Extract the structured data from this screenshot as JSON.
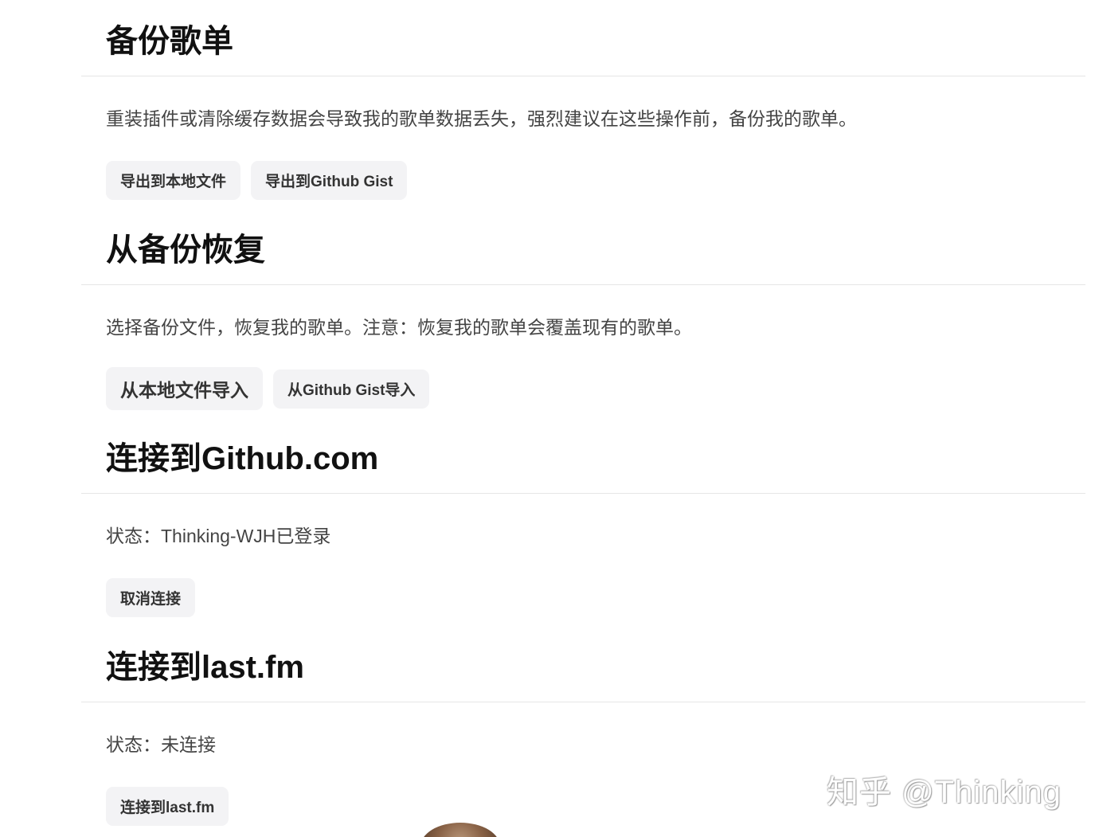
{
  "sections": {
    "backup": {
      "title": "备份歌单",
      "description": "重装插件或清除缓存数据会导致我的歌单数据丢失，强烈建议在这些操作前，备份我的歌单。",
      "buttons": {
        "export_local": "导出到本地文件",
        "export_gist": "导出到Github Gist"
      }
    },
    "restore": {
      "title": "从备份恢复",
      "description": "选择备份文件，恢复我的歌单。注意：恢复我的歌单会覆盖现有的歌单。",
      "buttons": {
        "import_local": "从本地文件导入",
        "import_gist": "从Github Gist导入"
      }
    },
    "github": {
      "title": "连接到Github.com",
      "status": "状态：Thinking-WJH已登录",
      "buttons": {
        "disconnect": "取消连接"
      }
    },
    "lastfm": {
      "title": "连接到last.fm",
      "status": "状态：未连接",
      "buttons": {
        "connect": "连接到last.fm"
      }
    }
  },
  "watermark": "知乎 @Thinking",
  "colors": {
    "button_bg": "#f3f3f5",
    "heading": "#111111",
    "text": "#444444",
    "divider": "#e6e6e6"
  }
}
